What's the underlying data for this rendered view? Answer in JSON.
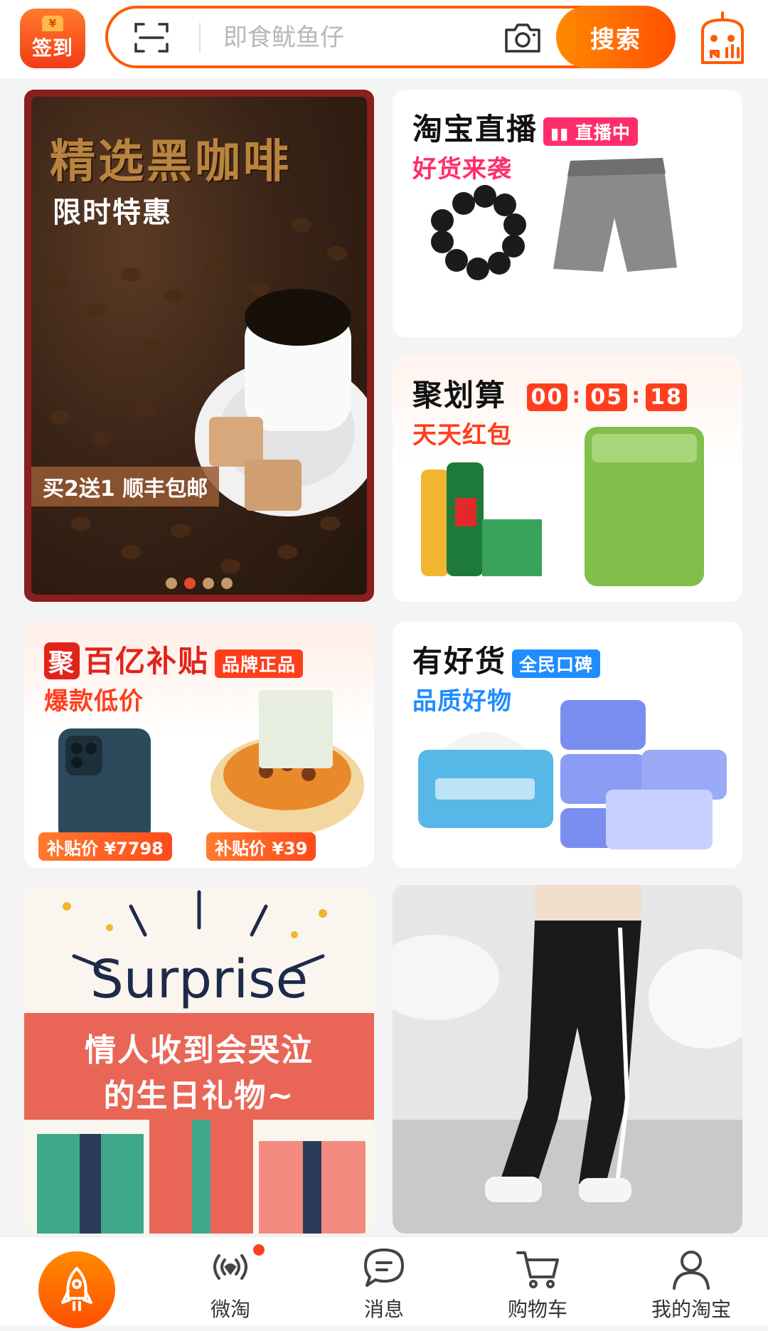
{
  "header": {
    "checkin_label": "签到",
    "coin_symbol": "¥",
    "search_placeholder": "即食鱿鱼仔",
    "search_button": "搜索"
  },
  "banner": {
    "title": "精选黑咖啡",
    "subtitle": "限时特惠",
    "promo": "买2送1 顺丰包邮",
    "dots": 4,
    "active_dot": 2
  },
  "cards": {
    "live": {
      "title": "淘宝直播",
      "tag": "直播中",
      "subtitle": "好货来袭",
      "tag_color": "#ff2e6a",
      "subtitle_color": "#ff2e6a"
    },
    "ju": {
      "title": "聚划算",
      "timer": [
        "00",
        "05",
        "18"
      ],
      "subtitle": "天天红包",
      "subtitle_color": "#ff3e1d"
    },
    "bai": {
      "brand_icon": "聚",
      "title": "百亿补贴",
      "tag": "品牌正品",
      "subtitle": "爆款低价",
      "subtitle_color": "#ff3e1d",
      "prices": [
        "补贴价 ¥7798",
        "补贴价 ¥39"
      ]
    },
    "you": {
      "title": "有好货",
      "tag": "全民口碑",
      "subtitle": "品质好物",
      "tag_color": "#1f8cff",
      "subtitle_color": "#1f8cff"
    }
  },
  "feed": {
    "surprise_word": "Surprise",
    "surprise_line1": "情人收到会哭泣",
    "surprise_line2": "的生日礼物~"
  },
  "nav": {
    "items": [
      {
        "label": "",
        "icon": "rocket-icon"
      },
      {
        "label": "微淘",
        "icon": "broadcast-icon"
      },
      {
        "label": "消息",
        "icon": "message-icon"
      },
      {
        "label": "购物车",
        "icon": "cart-icon"
      },
      {
        "label": "我的淘宝",
        "icon": "user-icon"
      }
    ]
  },
  "colors": {
    "brand_orange": "#ff5000",
    "accent_red": "#ff3e1d"
  }
}
